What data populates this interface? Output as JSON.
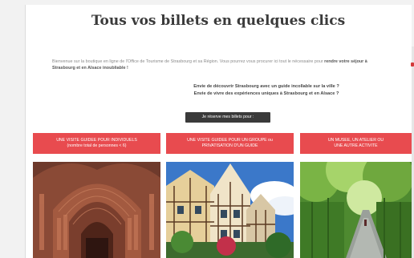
{
  "header": {
    "title": "Tous vos billets en quelques clics"
  },
  "intro": {
    "text_1": "Bienvenue sur la boutique en ligne de l'Office de Tourisme de Strasbourg et sa Région. Vous pourrez vous procurer ici tout le nécessaire pour ",
    "text_bold": "rendre votre séjour à Strasbourg et en Alsace inoubliable !"
  },
  "questions": {
    "line_1": "Envie de découvrir Strasbourg avec un guide incollable sur la ville ?",
    "line_2": "Envie de vivre des expériences uniques à Strasbourg et en Alsace ?"
  },
  "cta": {
    "label": "Je réserve mes billets pour :"
  },
  "categories": [
    {
      "line_1": "UNE VISITE GUIDEE POUR INDIVIDUELS",
      "line_2": "(nombre total de personnes < 6)"
    },
    {
      "line_1": "UNE VISITE GUIDEE POUR UN GROUPE ou",
      "line_2": "PRIVATISATION D'UN GUIDE"
    },
    {
      "line_1": "UN MUSEE, UN ATELIER OU",
      "line_2": "UNE AUTRE ACTIVITE"
    }
  ],
  "photos": [
    {
      "icon": "cathedral-portal-photo"
    },
    {
      "icon": "half-timbered-houses-photo"
    },
    {
      "icon": "forest-path-photo"
    }
  ],
  "colors": {
    "accent_red": "#e84b4f",
    "button_dark": "#3a3a3a"
  }
}
